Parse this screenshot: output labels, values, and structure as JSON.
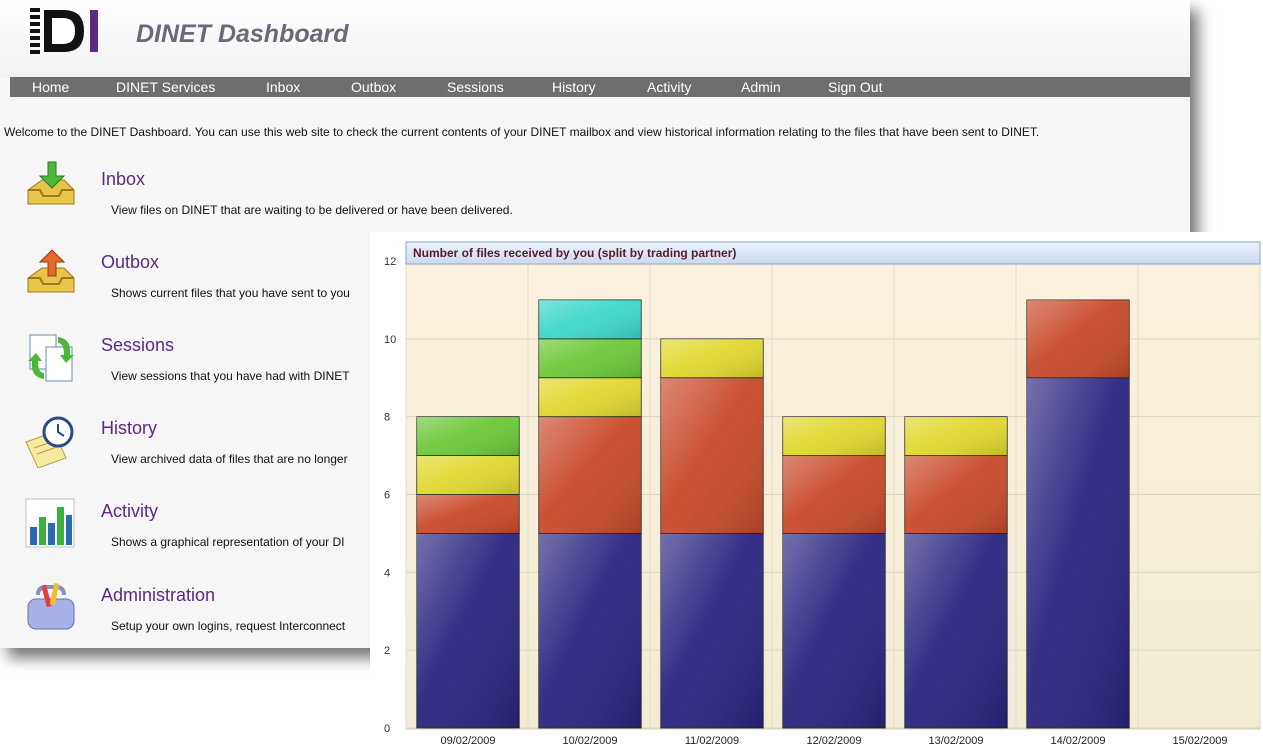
{
  "app": {
    "title": "DINET Dashboard",
    "logo_text": "DI"
  },
  "nav": [
    {
      "label": "Home"
    },
    {
      "label": "DINET Services"
    },
    {
      "label": "Inbox"
    },
    {
      "label": "Outbox"
    },
    {
      "label": "Sessions"
    },
    {
      "label": "History"
    },
    {
      "label": "Activity"
    },
    {
      "label": "Admin"
    },
    {
      "label": "Sign Out"
    }
  ],
  "welcome": "Welcome to the DINET Dashboard. You can use this web site to check the current contents of your DINET mailbox and view historical information relating to the files that have been sent to DINET.",
  "sections": [
    {
      "title": "Inbox",
      "desc": "View files on DINET that are waiting to be delivered or have been delivered.",
      "icon": "inbox-tray-icon"
    },
    {
      "title": "Outbox",
      "desc": "Shows current files that you have sent to you",
      "icon": "outbox-tray-icon"
    },
    {
      "title": "Sessions",
      "desc": "View sessions that you have had with DINET",
      "icon": "sessions-arrows-icon"
    },
    {
      "title": "History",
      "desc": "View archived data of files that are no longer",
      "icon": "history-clock-icon"
    },
    {
      "title": "Activity",
      "desc": "Shows a graphical representation of your DI",
      "icon": "activity-chart-icon"
    },
    {
      "title": "Administration",
      "desc": "Setup your own logins, request Interconnect",
      "icon": "admin-toolbox-icon"
    }
  ],
  "chart_data": {
    "type": "bar",
    "stacked": true,
    "title": "Number of files received by you (split by trading partner)",
    "categories": [
      "09/02/2009",
      "10/02/2009",
      "11/02/2009",
      "12/02/2009",
      "13/02/2009",
      "14/02/2009",
      "15/02/2009"
    ],
    "ylim": [
      0,
      12
    ],
    "yticks": [
      0,
      2,
      4,
      6,
      8,
      10,
      12
    ],
    "grid": true,
    "series": [
      {
        "color": "#2a2480",
        "values": [
          5,
          5,
          5,
          5,
          5,
          9,
          0
        ]
      },
      {
        "color": "#c84a2a",
        "values": [
          1,
          3,
          4,
          2,
          2,
          2,
          0
        ]
      },
      {
        "color": "#e0d830",
        "values": [
          1,
          1,
          1,
          1,
          1,
          0,
          0
        ]
      },
      {
        "color": "#6cc83a",
        "values": [
          1,
          1,
          0,
          0,
          0,
          0,
          0
        ]
      },
      {
        "color": "#3cd8c8",
        "values": [
          0,
          1,
          0,
          0,
          0,
          0,
          0
        ]
      }
    ]
  }
}
